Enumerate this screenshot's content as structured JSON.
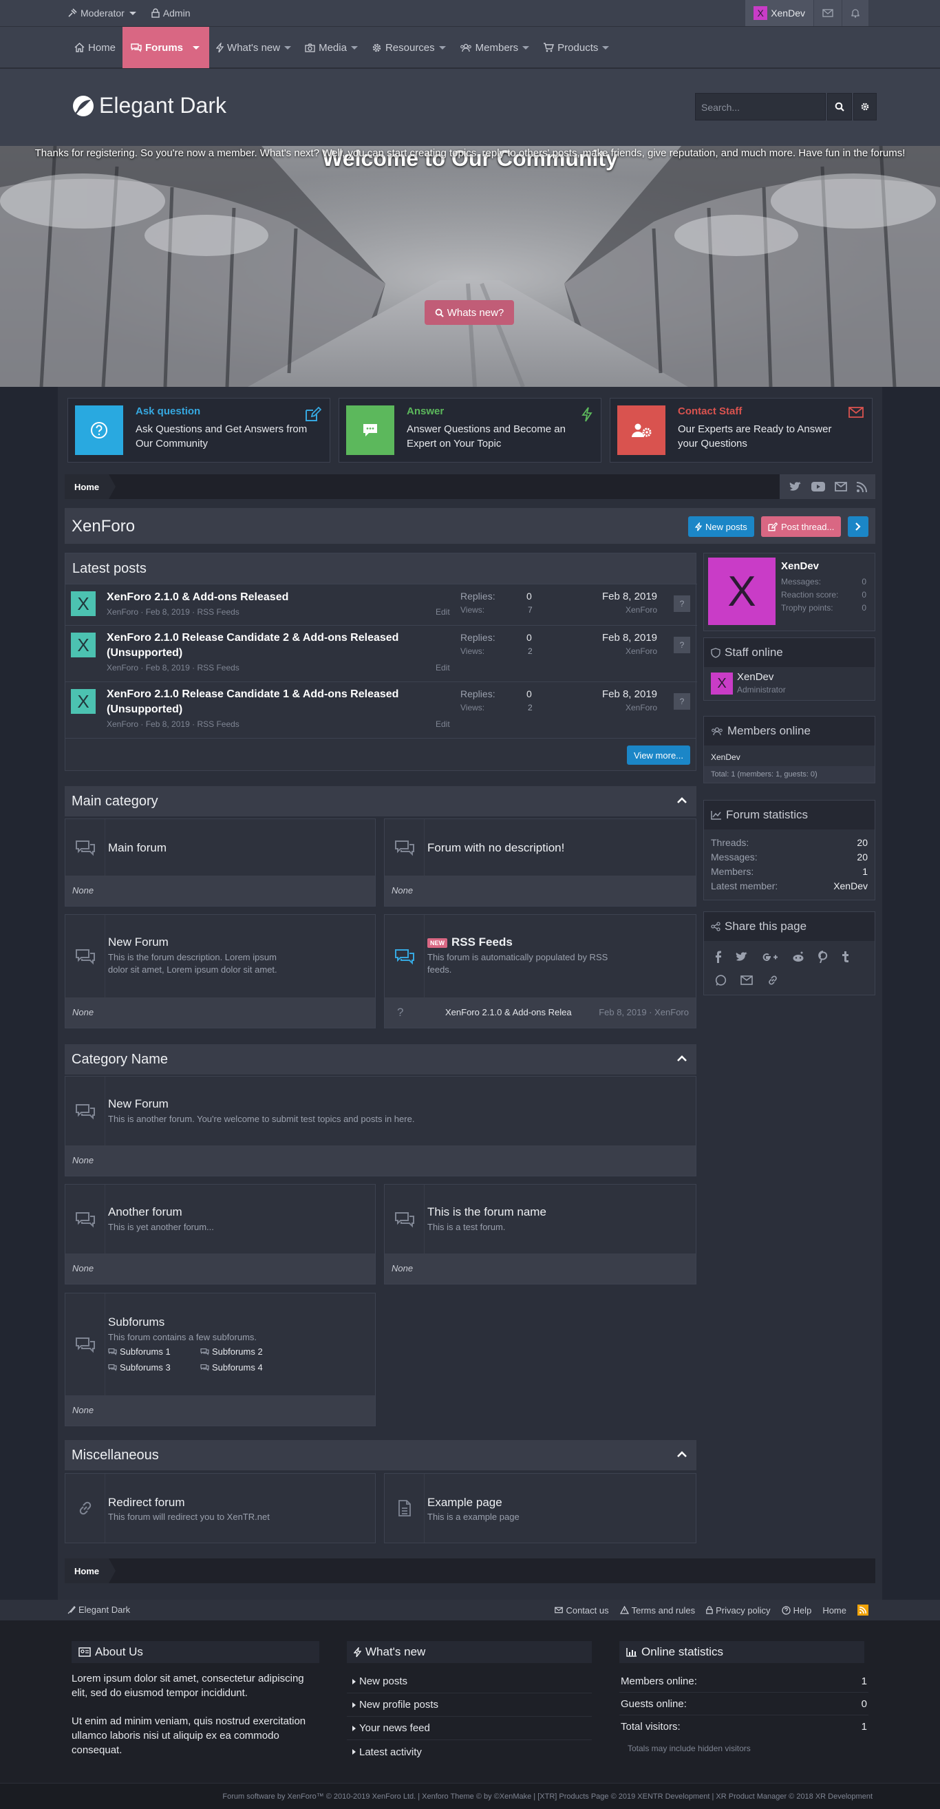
{
  "topbar": {
    "moderator": "Moderator",
    "admin": "Admin",
    "user": "XenDev",
    "avatar_letter": "X"
  },
  "nav": {
    "home": "Home",
    "forums": "Forums",
    "whats_new": "What's new",
    "media": "Media",
    "resources": "Resources",
    "members": "Members",
    "products": "Products"
  },
  "header": {
    "logo": "Elegant Dark",
    "search_placeholder": "Search..."
  },
  "hero": {
    "title": "Welcome to Our Community",
    "text": "Thanks for registering. So you're now a member. What's next? Well, you can start creating topics, reply to others' posts, make friends, give reputation, and much more. Have fun in the forums!",
    "button": "Whats new?"
  },
  "features": [
    {
      "title": "Ask question",
      "desc": "Ask Questions and Get Answers from Our Community",
      "color": "#29a9e0",
      "title_color": "#36a8e0"
    },
    {
      "title": "Answer",
      "desc": "Answer Questions and Become an Expert on Your Topic",
      "color": "#5cb85c",
      "title_color": "#5cb85c"
    },
    {
      "title": "Contact Staff",
      "desc": "Our Experts are Ready to Answer your Questions",
      "color": "#d9534f",
      "title_color": "#d9534f"
    }
  ],
  "breadcrumb": {
    "home": "Home"
  },
  "page": {
    "title": "XenForo",
    "new_posts": "New posts",
    "post_thread": "Post thread..."
  },
  "latest": {
    "title": "Latest posts",
    "replies_label": "Replies:",
    "views_label": "Views:",
    "edit": "Edit",
    "view_more": "View more...",
    "posts": [
      {
        "title": "XenForo 2.1.0 & Add-ons Released",
        "author": "XenForo",
        "date": "Feb 8, 2019",
        "forum": "RSS Feeds",
        "replies": "0",
        "views": "7",
        "last_date": "Feb 8, 2019",
        "last_user": "XenForo",
        "avatar": "X"
      },
      {
        "title": "XenForo 2.1.0 Release Candidate 2 & Add-ons Released (Unsupported)",
        "author": "XenForo",
        "date": "Feb 8, 2019",
        "forum": "RSS Feeds",
        "replies": "0",
        "views": "2",
        "last_date": "Feb 8, 2019",
        "last_user": "XenForo",
        "avatar": "X"
      },
      {
        "title": "XenForo 2.1.0 Release Candidate 1 & Add-ons Released (Unsupported)",
        "author": "XenForo",
        "date": "Feb 8, 2019",
        "forum": "RSS Feeds",
        "replies": "0",
        "views": "2",
        "last_date": "Feb 8, 2019",
        "last_user": "XenForo",
        "avatar": "X"
      }
    ]
  },
  "cats": {
    "main": {
      "title": "Main category"
    },
    "cat2": {
      "title": "Category Name"
    },
    "misc": {
      "title": "Miscellaneous"
    }
  },
  "forums": {
    "main_forum": {
      "name": "Main forum",
      "last": "None"
    },
    "no_desc": {
      "name": "Forum with no description!",
      "last": "None"
    },
    "new_forum1": {
      "name": "New Forum",
      "desc": "This is the forum description. Lorem ipsum dolor sit amet, Lorem ipsum dolor sit amet.",
      "last": "None"
    },
    "rss": {
      "name": "RSS Feeds",
      "badge": "NEW",
      "desc": "This forum is automatically populated by RSS feeds.",
      "last_title": "XenForo 2.1.0 & Add-ons Relea",
      "last_meta": "Feb 8, 2019 · XenForo",
      "q": "?"
    },
    "new_forum2": {
      "name": "New Forum",
      "desc": "This is another forum. You're welcome to submit test topics and posts in here.",
      "last": "None"
    },
    "another": {
      "name": "Another forum",
      "desc": "This is yet another forum...",
      "last": "None"
    },
    "forum_name": {
      "name": "This is the forum name",
      "desc": "This is a test forum.",
      "last": "None"
    },
    "subforums": {
      "name": "Subforums",
      "desc": "This forum contains a few subforums.",
      "subs": [
        "Subforums 1",
        "Subforums 2",
        "Subforums 3",
        "Subforums 4"
      ],
      "last": "None"
    },
    "redirect": {
      "name": "Redirect forum",
      "desc": "This forum will redirect you to XenTR.net"
    },
    "example": {
      "name": "Example page",
      "desc": "This is a example page"
    }
  },
  "sidebar": {
    "user": {
      "name": "XenDev",
      "avatar": "X",
      "messages_label": "Messages:",
      "messages": "0",
      "reaction_label": "Reaction score:",
      "reaction": "0",
      "trophy_label": "Trophy points:",
      "trophy": "0"
    },
    "staff": {
      "title": "Staff online",
      "name": "XenDev",
      "role": "Administrator",
      "avatar": "X"
    },
    "members": {
      "title": "Members online",
      "name": "XenDev",
      "total": "Total: 1 (members: 1, guests: 0)"
    },
    "stats": {
      "title": "Forum statistics",
      "threads_label": "Threads:",
      "threads": "20",
      "messages_label": "Messages:",
      "messages": "20",
      "members_label": "Members:",
      "members": "1",
      "latest_label": "Latest member:",
      "latest": "XenDev"
    },
    "share": {
      "title": "Share this page"
    }
  },
  "footer": {
    "style": "Elegant Dark",
    "contact": "Contact us",
    "terms": "Terms and rules",
    "privacy": "Privacy policy",
    "help": "Help",
    "home": "Home",
    "about_title": "About Us",
    "about_p1": "Lorem ipsum dolor sit amet, consectetur adipiscing elit, sed do eiusmod tempor incididunt.",
    "about_p2": "Ut enim ad minim veniam, quis nostrud exercitation ullamco laboris nisi ut aliquip ex ea commodo consequat.",
    "whatsnew_title": "What's new",
    "links": [
      "New posts",
      "New profile posts",
      "Your news feed",
      "Latest activity"
    ],
    "online_title": "Online statistics",
    "online": [
      {
        "k": "Members online:",
        "v": "1"
      },
      {
        "k": "Guests online:",
        "v": "0"
      },
      {
        "k": "Total visitors:",
        "v": "1"
      }
    ],
    "online_note": "Totals may include hidden visitors",
    "copyright": "Forum software by XenForo™ © 2010-2019 XenForo Ltd. | Xenforo Theme © by ©XenMake | [XTR] Products Page © 2019 XENTR Development | XR Product Manager © 2018 XR Development"
  }
}
